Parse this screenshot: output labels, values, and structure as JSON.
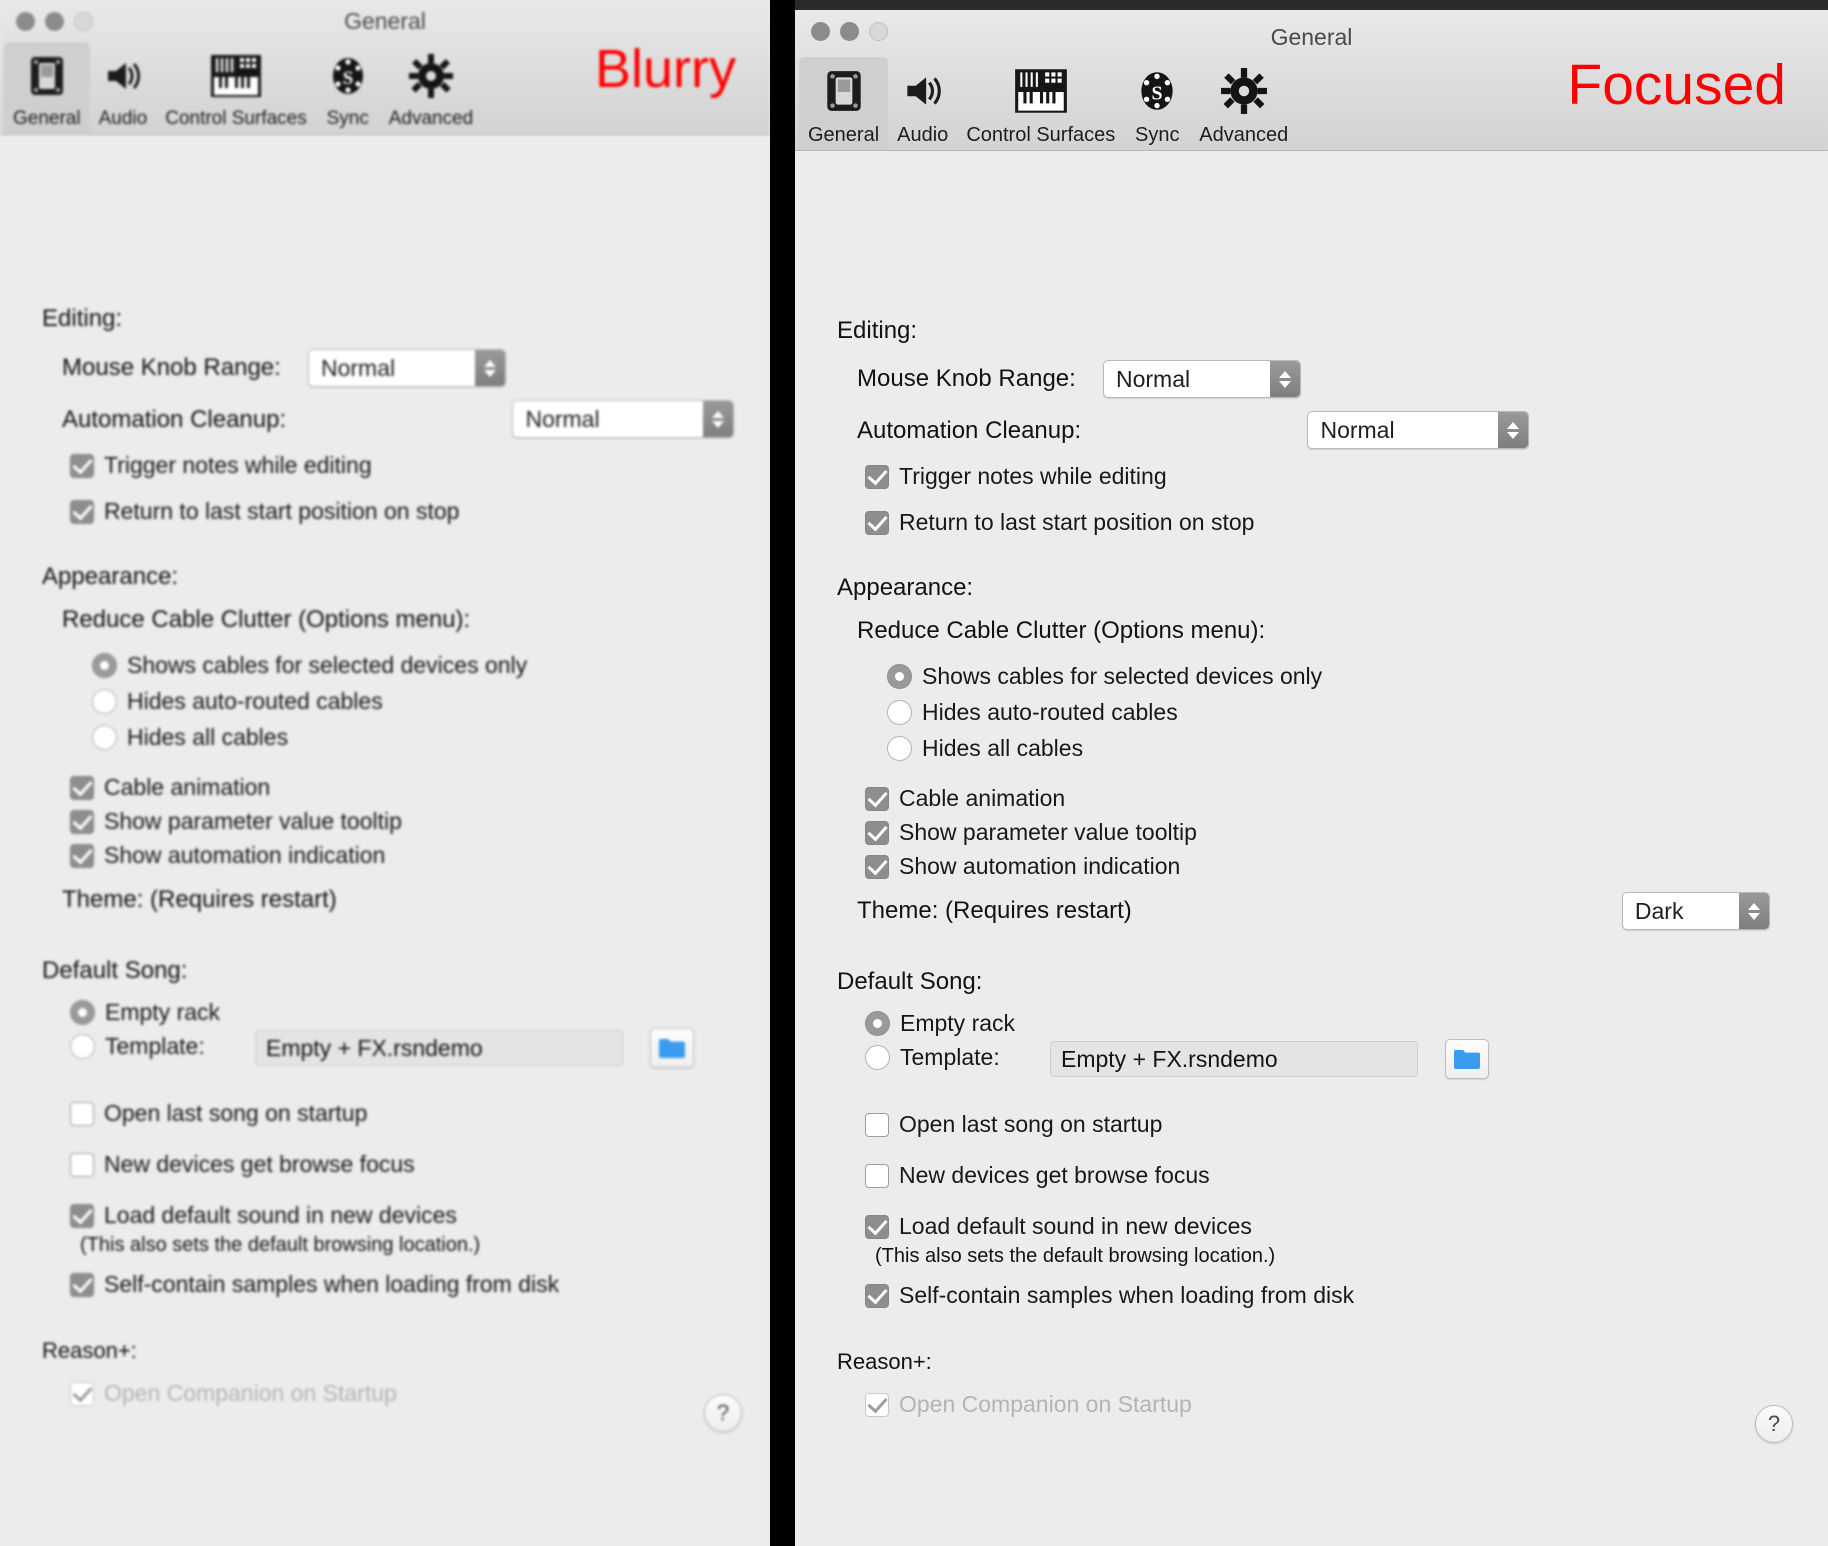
{
  "panels": [
    {
      "id": "left",
      "annotation": "Blurry",
      "window_title": "General"
    },
    {
      "id": "right",
      "annotation": "Focused",
      "window_title": "General"
    }
  ],
  "toolbar": {
    "tabs": [
      {
        "label": "General",
        "icon": "rack-device-icon",
        "selected": true
      },
      {
        "label": "Audio",
        "icon": "speaker-icon",
        "selected": false
      },
      {
        "label": "Control Surfaces",
        "icon": "midi-keyboard-icon",
        "selected": false
      },
      {
        "label": "Sync",
        "icon": "sync-s-badge-icon",
        "selected": false
      },
      {
        "label": "Advanced",
        "icon": "gear-icon",
        "selected": false
      }
    ]
  },
  "sections": {
    "editing": {
      "title": "Editing:",
      "mouse_knob_range": {
        "label": "Mouse Knob Range:",
        "value": "Normal"
      },
      "automation_cleanup": {
        "label": "Automation Cleanup:",
        "value": "Normal"
      },
      "checkboxes": [
        {
          "label": "Trigger notes while editing",
          "checked": true
        },
        {
          "label": "Return to last start position on stop",
          "checked": true
        }
      ]
    },
    "appearance": {
      "title": "Appearance:",
      "cable_clutter_label": "Reduce Cable Clutter (Options menu):",
      "cable_clutter_options": [
        {
          "label": "Shows cables for selected devices only",
          "selected": true
        },
        {
          "label": "Hides auto-routed cables",
          "selected": false
        },
        {
          "label": "Hides all cables",
          "selected": false
        }
      ],
      "checkboxes": [
        {
          "label": "Cable animation",
          "checked": true
        },
        {
          "label": "Show parameter value tooltip",
          "checked": true
        },
        {
          "label": "Show automation indication",
          "checked": true
        }
      ],
      "theme": {
        "label": "Theme: (Requires restart)",
        "value": "Dark"
      }
    },
    "default_song": {
      "title": "Default Song:",
      "options": [
        {
          "label": "Empty rack",
          "selected": true
        },
        {
          "label": "Template:",
          "selected": false
        }
      ],
      "template_path": "Empty + FX.rsndemo",
      "browse_icon": "folder-icon",
      "checkboxes": [
        {
          "label": "Open last song on startup",
          "checked": false
        },
        {
          "label": "New devices get browse focus",
          "checked": false
        },
        {
          "label": "Load default sound in new devices",
          "checked": true
        },
        {
          "label": "Self-contain samples when loading from disk",
          "checked": true
        }
      ],
      "note": "(This also sets the default browsing location.)"
    },
    "reason_plus": {
      "title": "Reason+:",
      "checkbox": {
        "label": "Open Companion on Startup",
        "checked": true,
        "disabled": true
      }
    }
  },
  "help": {
    "label": "?"
  },
  "colors": {
    "annotation": "#ff0000",
    "window_bg": "#ececec",
    "titlebar_bg": "#dcdcdc",
    "control_accent": "#8e8e8e"
  }
}
